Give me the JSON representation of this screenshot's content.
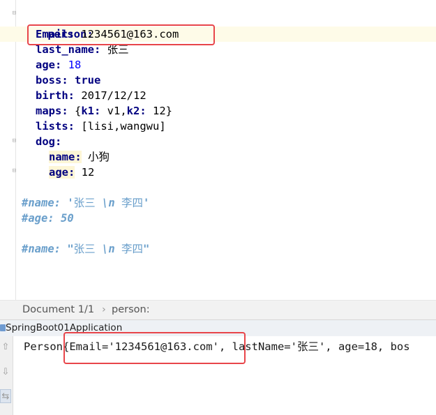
{
  "editor": {
    "line_person_key": "person:",
    "email_key": "Email:",
    "email_val": " 1234561@163.com",
    "last_name_key": "last_name:",
    "last_name_val": " 张三",
    "age_key": "age:",
    "age_val": " 18",
    "boss_key": "boss:",
    "boss_val": " true",
    "birth_key": "birth:",
    "birth_val": " 2017/12/12",
    "maps_key": "maps:",
    "maps_open": " {",
    "maps_k1": "k1:",
    "maps_v1": " v1,",
    "maps_k2": "k2:",
    "maps_v2": " 12}",
    "lists_key": "lists:",
    "lists_val": " [lisi,wangwu]",
    "dog_key": "dog:",
    "dog_name_key": "name:",
    "dog_name_val": " 小狗",
    "dog_age_key": "age:",
    "dog_age_val": " 12",
    "comment1_prefix": "#name: '",
    "comment1_cn1": "张三",
    "comment1_mid": " \\n ",
    "comment1_cn2": "李四",
    "comment1_suffix": "'",
    "comment2": "#age: 50",
    "comment3_prefix": "#name: \"",
    "comment3_cn1": "张三",
    "comment3_mid": " \\n ",
    "comment3_cn2": "李四",
    "comment3_suffix": "\""
  },
  "breadcrumb": {
    "doc": "Document 1/1",
    "sep": "›",
    "path": "person:"
  },
  "run": {
    "title": "SpringBoot01Application"
  },
  "console": {
    "prefix": "Person",
    "boxed": "{Email='1234561@163.com',",
    "rest": " lastName='张三', age=18, bos"
  },
  "icons": [
    "fold-icon",
    "run-config-icon",
    "scroll-up-icon",
    "scroll-down-icon",
    "soft-wrap-icon"
  ],
  "colors": {
    "highlight_box": "#e8454a",
    "yaml_key": "#000080",
    "comment": "#6a9fcb",
    "number": "#0000ff"
  }
}
